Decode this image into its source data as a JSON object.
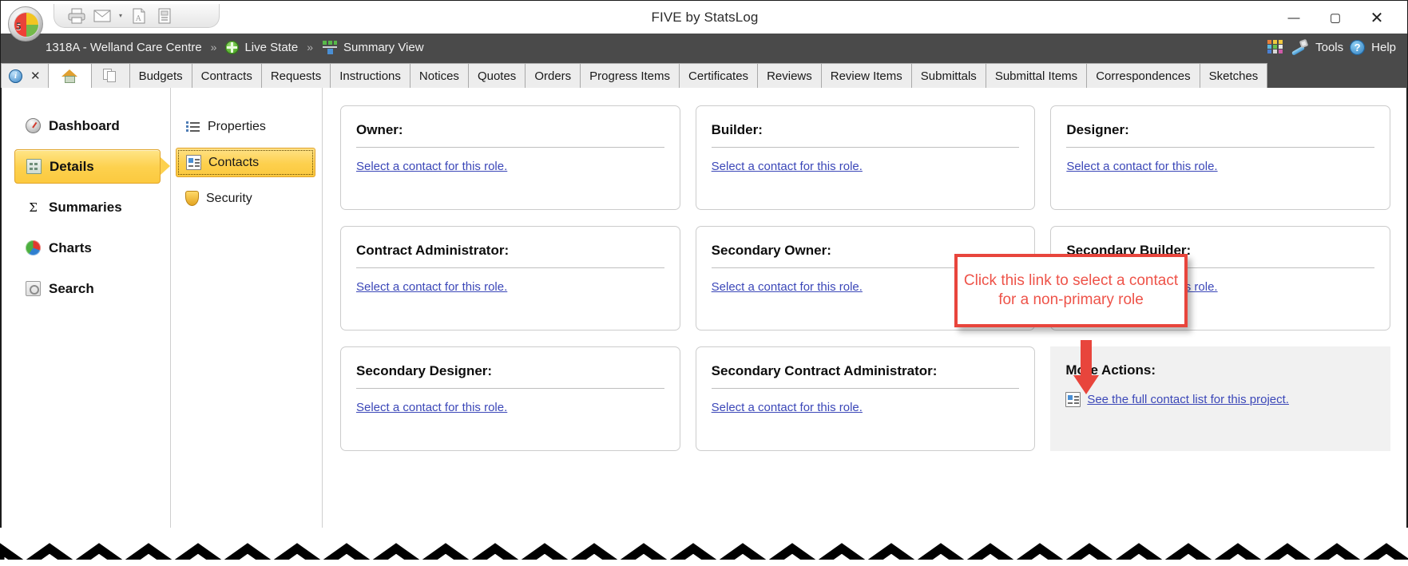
{
  "window": {
    "title": "FIVE by StatsLog",
    "minimize_label": "—",
    "maximize_label": "▢",
    "close_label": "✕",
    "orb_label": "5"
  },
  "quick_access": {
    "buttons": [
      {
        "name": "print-icon",
        "label": ""
      },
      {
        "name": "email-icon",
        "label": ""
      },
      {
        "name": "email-dropdown-caret",
        "label": "▾"
      },
      {
        "name": "export-pdf-icon",
        "label": ""
      },
      {
        "name": "export-report-icon",
        "label": ""
      }
    ]
  },
  "breadcrumb": {
    "separator": "»",
    "items": [
      {
        "label": "1318A - Welland Care Centre",
        "icon": ""
      },
      {
        "label": "Live State",
        "icon": "live-state-icon"
      },
      {
        "label": "Summary View",
        "icon": "summary-view-icon"
      }
    ]
  },
  "header_right": {
    "apps_label": "",
    "tools_label": "Tools",
    "help_label": "Help",
    "help_glyph": "?"
  },
  "tabs": {
    "info_glyph": "i",
    "close_glyph": "✕",
    "items": [
      "Budgets",
      "Contracts",
      "Requests",
      "Instructions",
      "Notices",
      "Quotes",
      "Orders",
      "Progress Items",
      "Certificates",
      "Reviews",
      "Review Items",
      "Submittals",
      "Submittal Items",
      "Correspondences",
      "Sketches"
    ]
  },
  "nav_primary": {
    "items": [
      {
        "label": "Dashboard",
        "icon": "dashboard-icon",
        "selected": false
      },
      {
        "label": "Details",
        "icon": "details-icon",
        "selected": true
      },
      {
        "label": "Summaries",
        "icon": "sigma-icon",
        "selected": false
      },
      {
        "label": "Charts",
        "icon": "pie-chart-icon",
        "selected": false
      },
      {
        "label": "Search",
        "icon": "search-icon",
        "selected": false
      }
    ]
  },
  "nav_secondary": {
    "items": [
      {
        "label": "Properties",
        "icon": "properties-icon",
        "selected": false
      },
      {
        "label": "Contacts",
        "icon": "contact-card-icon",
        "selected": true
      },
      {
        "label": "Security",
        "icon": "shield-icon",
        "selected": false
      }
    ]
  },
  "contacts": {
    "link_label": "Select a contact for this role.",
    "cards": [
      {
        "title": "Owner:"
      },
      {
        "title": "Builder:"
      },
      {
        "title": "Designer:"
      },
      {
        "title": "Contract Administrator:"
      },
      {
        "title": "Secondary Owner:"
      },
      {
        "title": "Secondary Builder:"
      },
      {
        "title": "Secondary Designer:"
      },
      {
        "title": "Secondary Contract Administrator:"
      }
    ],
    "more_actions": {
      "title": "More Actions:",
      "link": "See the full contact list for this project.",
      "icon": "contact-card-icon"
    }
  },
  "callout": {
    "text": "Click this link to select a contact for a non-primary role",
    "color": "#ee5349",
    "border_color": "#e8453c"
  },
  "colors": {
    "chrome_bar": "#4a4a4a",
    "selected_nav": "#fdd14e",
    "link": "#3b47b8",
    "callout_red": "#e8453c"
  }
}
